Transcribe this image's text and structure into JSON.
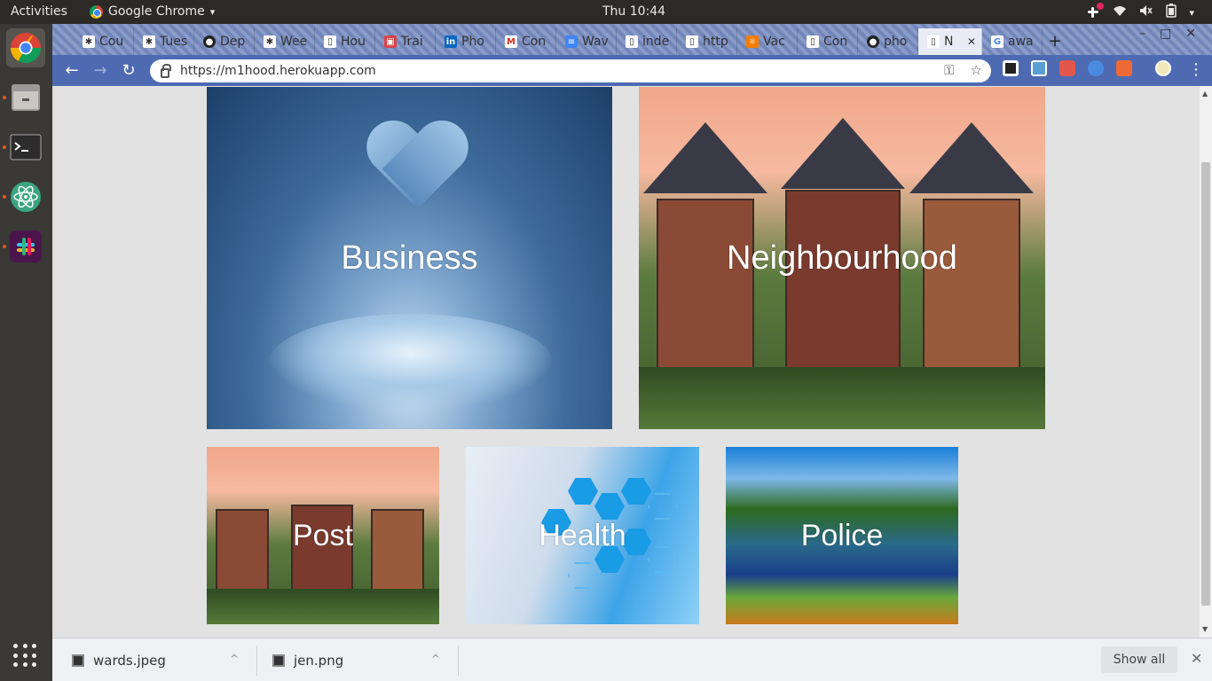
{
  "system": {
    "activities": "Activities",
    "app_name": "Google Chrome",
    "app_menu_arrow": "▾",
    "clock": "Thu 10:44",
    "tray": {
      "wifi": "wifi-icon",
      "volume": "volume-icon",
      "battery": "battery-icon",
      "power_arrow": "▾"
    }
  },
  "tabs": [
    {
      "label": "Cou",
      "icon": "gear"
    },
    {
      "label": "Tues",
      "icon": "gear"
    },
    {
      "label": "Dep",
      "icon": "github"
    },
    {
      "label": "Wee",
      "icon": "gear"
    },
    {
      "label": "Hou",
      "icon": "doc"
    },
    {
      "label": "Trai",
      "icon": "train"
    },
    {
      "label": "Pho",
      "icon": "linkedin"
    },
    {
      "label": "Con",
      "icon": "gmail"
    },
    {
      "label": "Wav",
      "icon": "docs"
    },
    {
      "label": "inde",
      "icon": "doc"
    },
    {
      "label": "http",
      "icon": "doc"
    },
    {
      "label": "Vac",
      "icon": "sun"
    },
    {
      "label": "Con",
      "icon": "doc"
    },
    {
      "label": "pho",
      "icon": "github"
    },
    {
      "label": "N",
      "icon": "doc",
      "active": true
    },
    {
      "label": "awa",
      "icon": "google"
    }
  ],
  "tab_new": "+",
  "window": {
    "minimize": "–",
    "maximize": "□",
    "close": "✕"
  },
  "tab_close": "✕",
  "toolbar": {
    "url": "https://m1hood.herokuapp.com",
    "back": "←",
    "forward": "→",
    "reload": "↻",
    "key_icon": "⚿",
    "star_icon": "☆",
    "menu": "⋮"
  },
  "cards": {
    "business": "Business",
    "neighbourhood": "Neighbourhood",
    "post": "Post",
    "health": "Health",
    "police": "Police"
  },
  "downloads": [
    {
      "name": "wards.jpeg"
    },
    {
      "name": "jen.png"
    }
  ],
  "downloads_bar": {
    "show_all": "Show all",
    "close": "✕",
    "chevron": "^"
  },
  "colors": {
    "toolbar": "#4e6ab2",
    "tabstrip": "#7d8fc0",
    "page_bg": "#e2e2e2",
    "dock": "#3a3935"
  }
}
